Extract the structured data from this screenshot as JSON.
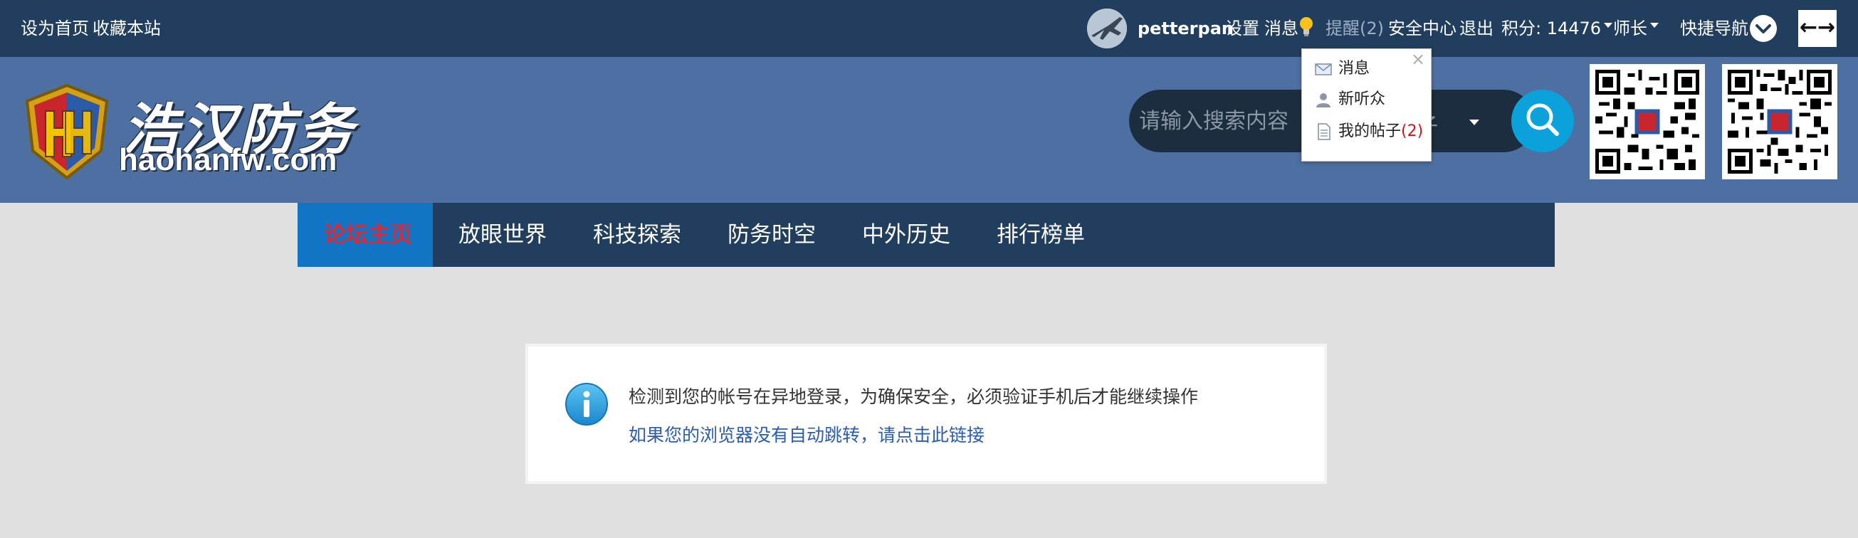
{
  "topbar": {
    "set_home": "设为首页",
    "bookmark": "收藏本站",
    "username": "petterpan",
    "settings": "设置",
    "messages": "消息",
    "reminders": "提醒(2)",
    "security_center": "安全中心",
    "logout": "退出",
    "points": "积分: 14476",
    "rank": "师长",
    "quick_nav": "快捷导航",
    "expand_label": "←→"
  },
  "logo": {
    "cn": "浩汉防务",
    "en": "haohanfw.com"
  },
  "search": {
    "placeholder": "请输入搜索内容",
    "type": "帖子"
  },
  "nav": {
    "items": [
      "论坛主页",
      "放眼世界",
      "科技探索",
      "防务时空",
      "中外历史",
      "排行榜单"
    ],
    "active_index": 0
  },
  "dropdown": {
    "close": "×",
    "items": [
      {
        "label": "消息",
        "icon": "envelope-icon"
      },
      {
        "label": "新听众",
        "icon": "user-icon"
      },
      {
        "label": "我的帖子",
        "count": "(2)",
        "icon": "document-icon"
      }
    ]
  },
  "notice": {
    "line1": "检测到您的帐号在异地登录，为确保安全，必须验证手机后才能继续操作",
    "link": "如果您的浏览器没有自动跳转，请点击此链接"
  },
  "colors": {
    "topbar": "#223e5e",
    "header": "#4d6fa2",
    "nav_active": "#1174c5",
    "active_text": "#e8232a",
    "search_btn": "#0ba2dc",
    "link": "#2a5db0"
  }
}
